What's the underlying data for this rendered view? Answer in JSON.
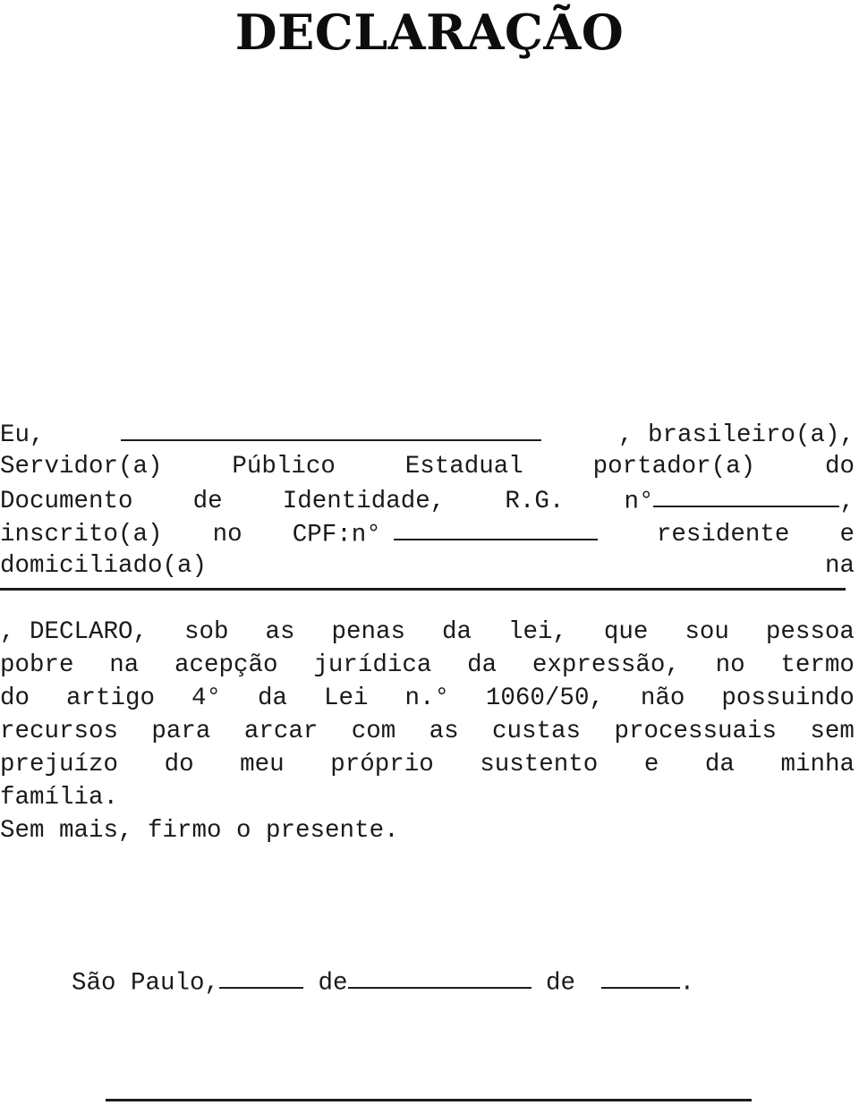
{
  "document": {
    "title": "DECLARAÇÃO",
    "language": "pt-BR"
  },
  "body": {
    "lines": [
      {
        "id": "line-1",
        "segments": [
          "Eu,",
          "",
          ", brasileiro(a),"
        ],
        "text": "Eu, ______________________, brasileiro(a),"
      },
      {
        "id": "line-2",
        "segments": [
          "Servidor(a)",
          "Público",
          "Estadual",
          "portador(a)",
          "do"
        ],
        "text": "Servidor(a) Público Estadual portador(a) do"
      },
      {
        "id": "line-3",
        "segments": [
          "Documento",
          "de",
          "Identidade,",
          "R.G.",
          "n°",
          ","
        ],
        "text": "Documento de Identidade, R.G. n°____________,"
      },
      {
        "id": "line-4",
        "segments": [
          "inscrito(a)",
          "no",
          "CPF:n°",
          "",
          "residente",
          "e"
        ],
        "text": "inscrito(a) no CPF:n° ______________ residente e"
      },
      {
        "id": "line-5",
        "segments": [
          "domiciliado(a)",
          "na"
        ],
        "text": "domiciliado(a) na"
      },
      {
        "id": "line-6",
        "segments": [
          ", DECLARO,",
          "sob",
          "as",
          "penas",
          "da",
          "lei,",
          "que",
          "sou",
          "pessoa"
        ],
        "text": ", DECLARO, sob as penas da lei, que sou pessoa"
      },
      {
        "id": "line-7",
        "segments": [
          "pobre",
          "na",
          "acepção",
          "jurídica",
          "da",
          "expressão,",
          "no",
          "termo"
        ],
        "text": "pobre na acepção jurídica da expressão, no termo"
      },
      {
        "id": "line-8",
        "segments": [
          "do",
          "artigo",
          "4°",
          "da",
          "Lei",
          "n.°",
          "1060/50,",
          "não",
          "possuindo"
        ],
        "text": "do artigo 4° da Lei n.° 1060/50, não possuindo"
      },
      {
        "id": "line-9",
        "segments": [
          "recursos",
          "para",
          "arcar",
          "com",
          "as",
          "custas",
          "processuais",
          "sem"
        ],
        "text": "recursos para arcar com as custas processuais sem"
      },
      {
        "id": "line-10",
        "segments": [
          "prejuízo",
          "do",
          "meu",
          "próprio",
          "sustento",
          "e",
          "da",
          "minha"
        ],
        "text": "prejuízo do meu próprio sustento e da minha"
      },
      {
        "id": "line-11",
        "segments": [
          "família."
        ],
        "text": "família."
      },
      {
        "id": "line-12",
        "segments": [
          "Sem mais, firmo o presente."
        ],
        "text": "Sem mais, firmo o presente."
      }
    ],
    "tokens": {
      "eu": "Eu,",
      "brasileiro": ", brasileiro(a),",
      "servidor": "Servidor(a)",
      "publico": "Público",
      "estadual": "Estadual",
      "portador": "portador(a)",
      "do": "do",
      "documento": "Documento",
      "de": "de",
      "identidade": "Identidade,",
      "rg_label": "R.G.",
      "rg_numero": "n°",
      "rg_virgula": ",",
      "inscrito": "inscrito(a)",
      "no": "no",
      "cpf_label": "CPF:n°",
      "residente": "residente",
      "e": "e",
      "domiciliado": "domiciliado(a)",
      "na": "na",
      "declaro": ", DECLARO,",
      "sob": "sob",
      "as": "as",
      "penas": "penas",
      "da": "da",
      "lei_virgula": "lei,",
      "que": "que",
      "sou": "sou",
      "pessoa": "pessoa",
      "pobre": "pobre",
      "na2": "na",
      "acepcao": "acepção",
      "juridica": "jurídica",
      "da2": "da",
      "expressao": "expressão,",
      "no2": "no",
      "termo": "termo",
      "do2": "do",
      "artigo": "artigo",
      "quarto": "4°",
      "da3": "da",
      "lei": "Lei",
      "n_ordinal": "n.°",
      "numero_lei": "1060/50,",
      "nao": "não",
      "possuindo": "possuindo",
      "recursos": "recursos",
      "para": "para",
      "arcar": "arcar",
      "com": "com",
      "as2": "as",
      "custas": "custas",
      "processuais": "processuais",
      "sem": "sem",
      "prejuizo": "prejuízo",
      "do3": "do",
      "meu": "meu",
      "proprio": "próprio",
      "sustento": "sustento",
      "e2": "e",
      "da4": "da",
      "minha": "minha",
      "familia": "família.",
      "sem_mais": "Sem mais, firmo o presente."
    }
  },
  "date_line": {
    "city": "São Paulo,",
    "de_1": " de",
    "de_2": " de ",
    "final_period": ".",
    "text": "São Paulo,_____ de___________ de ____."
  },
  "blanks": {
    "name_field": "",
    "rg_field": "",
    "cpf_field": "",
    "address_field": "",
    "day_field": "",
    "month_field": "",
    "year_field": "",
    "signature_field": ""
  },
  "colors": {
    "page_background": "#ffffff",
    "text": "#1a1a1a",
    "title": "#0d0d0d",
    "rule": "#1c1c1c"
  }
}
